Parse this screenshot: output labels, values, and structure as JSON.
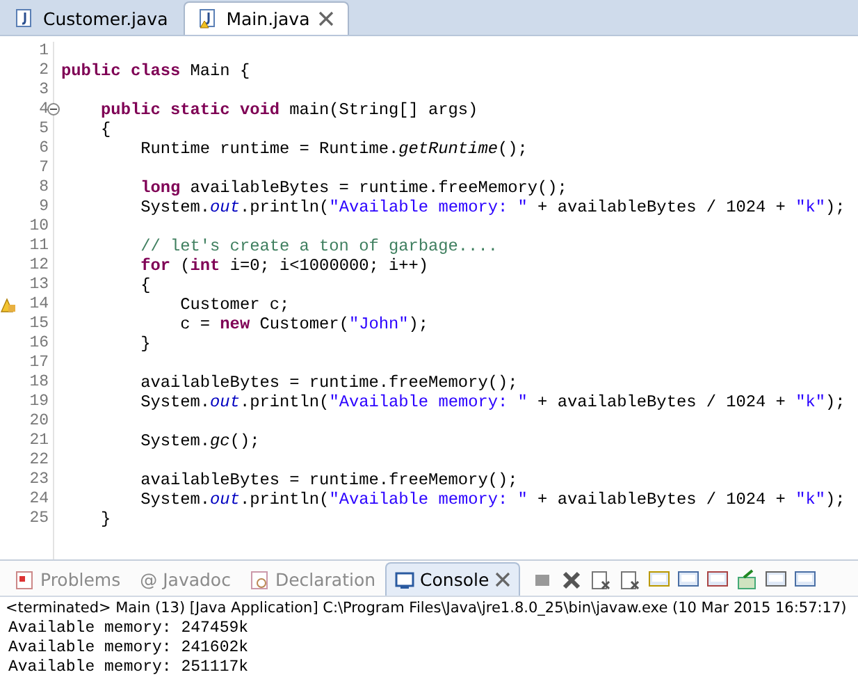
{
  "editor_tabs": [
    {
      "label": "Customer.java",
      "selected": false,
      "warning": false,
      "closable": false
    },
    {
      "label": "Main.java",
      "selected": true,
      "warning": true,
      "closable": true
    }
  ],
  "code_lines": [
    {
      "number": "1"
    },
    {
      "number": "2",
      "tokens": [
        {
          "kind": "kw",
          "text": "public class"
        },
        {
          "kind": "plain",
          "text": " Main {"
        }
      ]
    },
    {
      "number": "3"
    },
    {
      "number": "4",
      "kind": "fold",
      "tokens": [
        {
          "kind": "kw",
          "text": "    public static void"
        },
        {
          "kind": "plain",
          "text": " main(String[] args)"
        }
      ]
    },
    {
      "number": "5",
      "tokens": [
        {
          "kind": "plain",
          "text": "    {"
        }
      ]
    },
    {
      "number": "6",
      "tokens": [
        {
          "kind": "plain",
          "text": "        Runtime runtime = Runtime."
        },
        {
          "kind": "static",
          "text": "getRuntime"
        },
        {
          "kind": "plain",
          "text": "();"
        }
      ]
    },
    {
      "number": "7"
    },
    {
      "number": "8",
      "tokens": [
        {
          "kind": "kw",
          "text": "        long"
        },
        {
          "kind": "plain",
          "text": " availableBytes = runtime.freeMemory();"
        }
      ]
    },
    {
      "number": "9",
      "tokens": [
        {
          "kind": "plain",
          "text": "        System."
        },
        {
          "kind": "field",
          "text": "out"
        },
        {
          "kind": "plain",
          "text": ".println("
        },
        {
          "kind": "str",
          "text": "\"Available memory: \""
        },
        {
          "kind": "plain",
          "text": " + availableBytes / 1024 + "
        },
        {
          "kind": "str",
          "text": "\"k\""
        },
        {
          "kind": "plain",
          "text": ");"
        }
      ]
    },
    {
      "number": "10"
    },
    {
      "number": "11",
      "tokens": [
        {
          "kind": "comment",
          "text": "        // let's create a ton of garbage...."
        }
      ]
    },
    {
      "number": "12",
      "tokens": [
        {
          "kind": "kw",
          "text": "        for"
        },
        {
          "kind": "plain",
          "text": " ("
        },
        {
          "kind": "kw",
          "text": "int"
        },
        {
          "kind": "plain",
          "text": " i=0; i<1000000; i++)"
        }
      ]
    },
    {
      "number": "13",
      "tokens": [
        {
          "kind": "plain",
          "text": "        {"
        }
      ]
    },
    {
      "number": "14",
      "kind": "warning",
      "tokens": [
        {
          "kind": "plain",
          "text": "            Customer c;"
        }
      ]
    },
    {
      "number": "15",
      "tokens": [
        {
          "kind": "plain",
          "text": "            c = "
        },
        {
          "kind": "kw",
          "text": "new"
        },
        {
          "kind": "plain",
          "text": " Customer("
        },
        {
          "kind": "str",
          "text": "\"John\""
        },
        {
          "kind": "plain",
          "text": ");"
        }
      ]
    },
    {
      "number": "16",
      "tokens": [
        {
          "kind": "plain",
          "text": "        }"
        }
      ]
    },
    {
      "number": "17"
    },
    {
      "number": "18",
      "tokens": [
        {
          "kind": "plain",
          "text": "        availableBytes = runtime.freeMemory();"
        }
      ]
    },
    {
      "number": "19",
      "tokens": [
        {
          "kind": "plain",
          "text": "        System."
        },
        {
          "kind": "field",
          "text": "out"
        },
        {
          "kind": "plain",
          "text": ".println("
        },
        {
          "kind": "str",
          "text": "\"Available memory: \""
        },
        {
          "kind": "plain",
          "text": " + availableBytes / 1024 + "
        },
        {
          "kind": "str",
          "text": "\"k\""
        },
        {
          "kind": "plain",
          "text": ");"
        }
      ]
    },
    {
      "number": "20"
    },
    {
      "number": "21",
      "tokens": [
        {
          "kind": "plain",
          "text": "        System."
        },
        {
          "kind": "static",
          "text": "gc"
        },
        {
          "kind": "plain",
          "text": "();"
        }
      ]
    },
    {
      "number": "22"
    },
    {
      "number": "23",
      "tokens": [
        {
          "kind": "plain",
          "text": "        availableBytes = runtime.freeMemory();"
        }
      ]
    },
    {
      "number": "24",
      "tokens": [
        {
          "kind": "plain",
          "text": "        System."
        },
        {
          "kind": "field",
          "text": "out"
        },
        {
          "kind": "plain",
          "text": ".println("
        },
        {
          "kind": "str",
          "text": "\"Available memory: \""
        },
        {
          "kind": "plain",
          "text": " + availableBytes / 1024 + "
        },
        {
          "kind": "str",
          "text": "\"k\""
        },
        {
          "kind": "plain",
          "text": ");"
        }
      ]
    },
    {
      "number": "25",
      "tokens": [
        {
          "kind": "plain",
          "text": "    }"
        }
      ]
    }
  ],
  "panel_tabs": [
    {
      "kind": "problems",
      "label": "Problems",
      "selected": false
    },
    {
      "kind": "javadoc",
      "label": "@ Javadoc",
      "selected": false
    },
    {
      "kind": "declaration",
      "label": "Declaration",
      "selected": false
    },
    {
      "kind": "console",
      "label": "Console",
      "selected": true
    }
  ],
  "console": {
    "status": "<terminated> Main (13) [Java Application] C:\\Program Files\\Java\\jre1.8.0_25\\bin\\javaw.exe (10 Mar 2015 16:57:17)",
    "output": [
      "Available memory: 247459k",
      "Available memory: 241602k",
      "Available memory: 251117k"
    ]
  }
}
